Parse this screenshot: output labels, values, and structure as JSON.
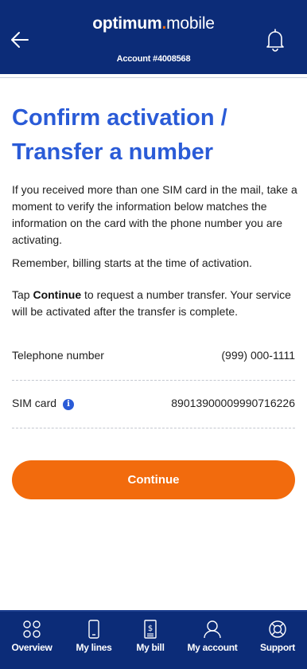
{
  "header": {
    "logo_primary": "optimum",
    "logo_dot": ".",
    "logo_secondary": "mobile",
    "account": "Account #4008568"
  },
  "page": {
    "title_line1": "Confirm activation /",
    "title_line2": "Transfer a number",
    "paragraph1": "If you received more than one SIM card in the mail, take a moment to verify the information below matches the information on the card with the phone number you are activating.",
    "paragraph2": "Remember, billing starts at the time of activation.",
    "paragraph3_prefix": "Tap ",
    "paragraph3_bold": "Continue",
    "paragraph3_suffix": " to request a number transfer. Your service will be activated after the transfer is complete."
  },
  "details": {
    "telephone_label": "Telephone number",
    "telephone_value": "(999) 000-1111",
    "sim_label": "SIM card",
    "sim_value": "89013900009990716226",
    "info_glyph": "i"
  },
  "actions": {
    "continue_label": "Continue"
  },
  "tabbar": {
    "items": [
      {
        "label": "Overview",
        "icon": "overview-icon"
      },
      {
        "label": "My lines",
        "icon": "phone-icon"
      },
      {
        "label": "My bill",
        "icon": "bill-icon"
      },
      {
        "label": "My account",
        "icon": "user-icon"
      },
      {
        "label": "Support",
        "icon": "lifebuoy-icon"
      }
    ]
  },
  "colors": {
    "navy": "#0c2c78",
    "accent_blue": "#2a5bd7",
    "orange": "#f26b0d"
  }
}
